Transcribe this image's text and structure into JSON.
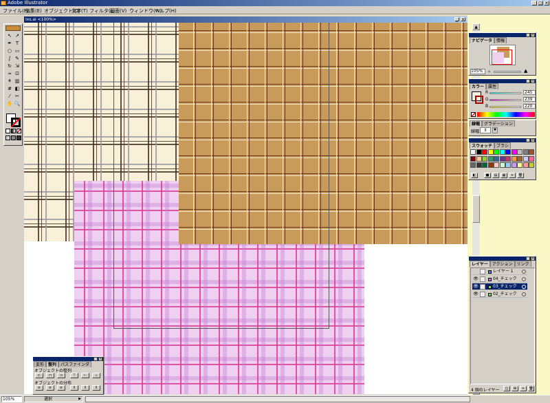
{
  "app": {
    "title": "Adobe Illustrator"
  },
  "menu": [
    "ファイル(F)",
    "編集(E)",
    "オブジェクト(O)",
    "文字(T)",
    "フィルタ(L)",
    "画面(V)",
    "ウィンドウ(W)",
    "ヘルプ(H)"
  ],
  "document": {
    "title": "Ixs.ai <100%>",
    "zoom": "105%",
    "status": "選択"
  },
  "navigator": {
    "tabs": [
      "ナビゲータ",
      "情報"
    ],
    "zoom": "105%"
  },
  "color": {
    "tabs": [
      "カラー",
      "属性"
    ],
    "channels": [
      {
        "label": "R",
        "value": "245"
      },
      {
        "label": "G",
        "value": "239"
      },
      {
        "label": "B",
        "value": "220"
      }
    ]
  },
  "stroke": {
    "tabs": [
      "線幅",
      "グラデーション"
    ],
    "label": "線幅"
  },
  "swatches": {
    "tabs": [
      "スウォッチ",
      "ブラシ"
    ],
    "colors": [
      "#ffffff",
      "#000000",
      "#ff0000",
      "#ffff00",
      "#00ff00",
      "#00ffff",
      "#0000ff",
      "#ff00ff",
      "#c0c0c0",
      "#808080",
      "#a0522d",
      "#800000",
      "#ffcc99",
      "#99cc33",
      "#339966",
      "#336699",
      "#663399",
      "#cc3366",
      "#ff9933",
      "#996633",
      "#ccccff",
      "#ff6699",
      "#666666",
      "#333333",
      "#006633",
      "#993300",
      "#ffcccc",
      "#ccffcc",
      "#99ccff",
      "#cc99ff",
      "#ffff99",
      "#ff9999",
      "#cccc33"
    ]
  },
  "layers": {
    "tabs": [
      "レイヤー",
      "アクション",
      "リンク"
    ],
    "items": [
      {
        "name": "レイヤー 1",
        "color": "#4f81ff",
        "visible": false,
        "selected": false
      },
      {
        "name": "04_チェック",
        "color": "#ff4fff",
        "visible": true,
        "selected": false
      },
      {
        "name": "03_チェック",
        "color": "#4fff4f",
        "visible": true,
        "selected": true
      },
      {
        "name": "02_チェック",
        "color": "#4fff4f",
        "visible": true,
        "selected": false
      }
    ],
    "count": "4 個のレイヤー"
  },
  "align": {
    "tabs": [
      "変形",
      "整列",
      "パスファインダ"
    ],
    "distribute_label": "オブジェクトの整列",
    "spacing_label": "オブジェクトの分布"
  }
}
